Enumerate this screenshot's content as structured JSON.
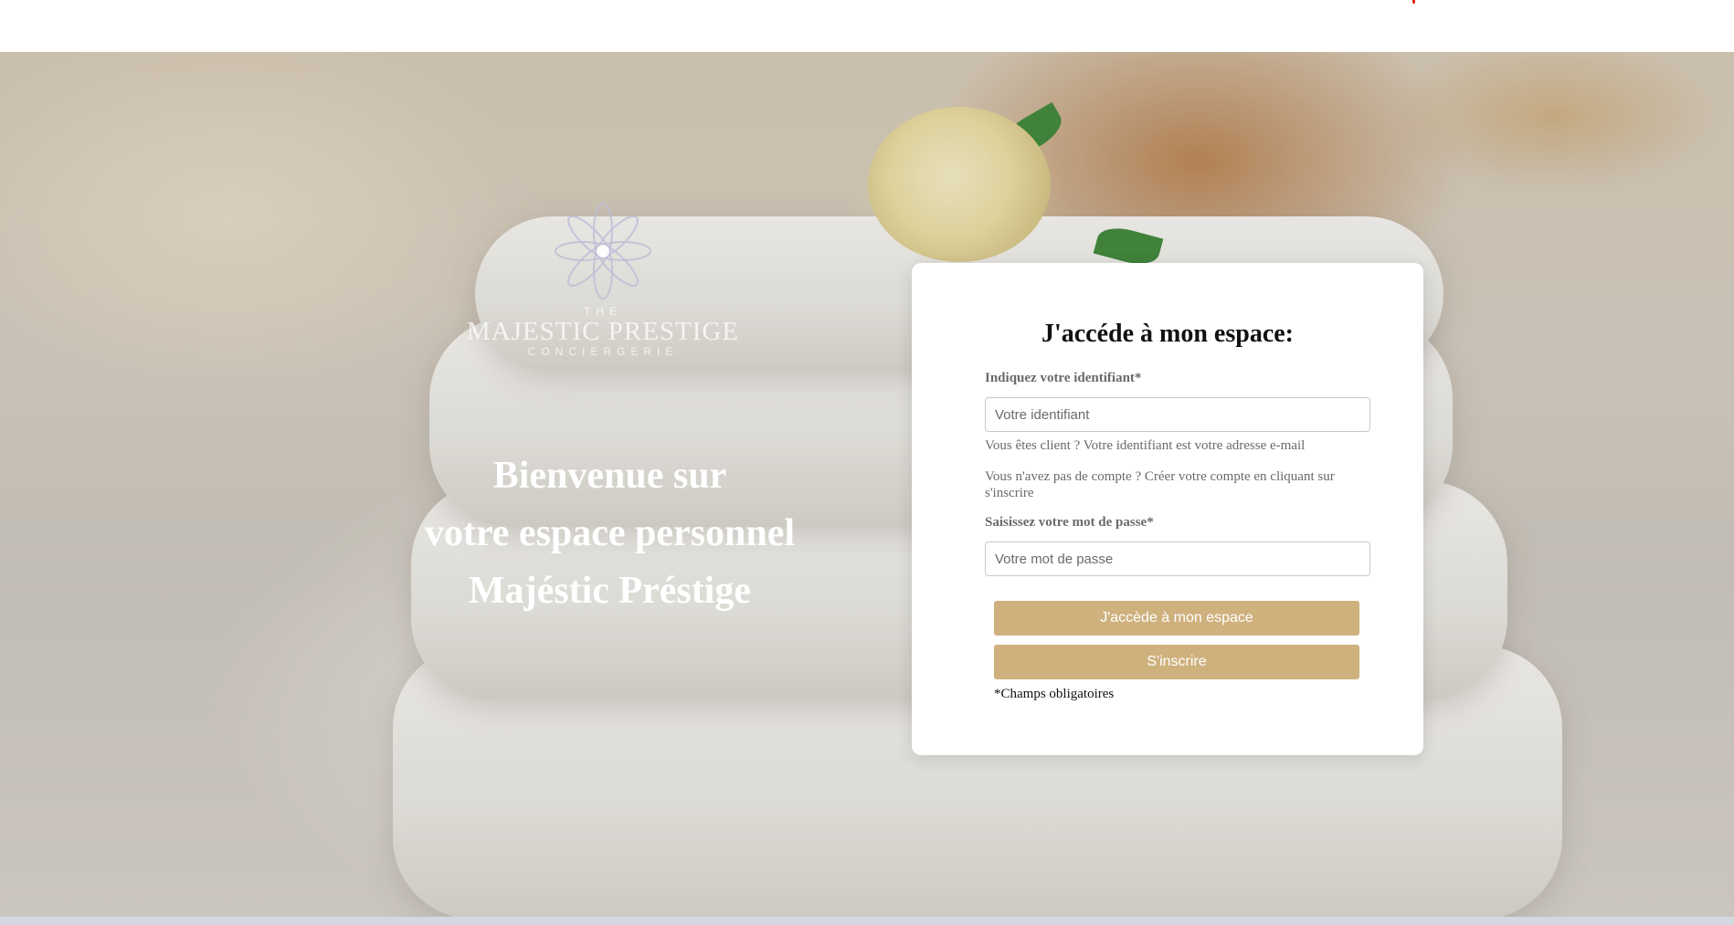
{
  "logo": {
    "the": "THE",
    "name": "MAJESTIC PRESTIGE",
    "subtitle": "CONCIERGERIE"
  },
  "welcome": {
    "line1": "Bienvenue sur",
    "line2": "votre espace personnel",
    "line3": "Majéstic Préstige"
  },
  "login": {
    "title": "J'accéde à mon espace:",
    "identifier_label": "Indiquez votre identifiant*",
    "identifier_placeholder": "Votre identifiant",
    "identifier_value": "",
    "hint_client": "Vous êtes client ? Votre identifiant est votre adresse e-mail",
    "hint_no_account": "Vous n'avez pas de compte ? Créer votre compte en cliquant sur s'inscrire",
    "password_label": "Saisissez votre mot de passe*",
    "password_placeholder": "Votre mot de passe",
    "password_value": "",
    "submit_label": "J'accède à mon espace",
    "register_label": "S'inscrire",
    "required_note": "*Champs obligatoires"
  },
  "colors": {
    "button": "#cfb17e",
    "accent_dot": "#d9230f"
  }
}
